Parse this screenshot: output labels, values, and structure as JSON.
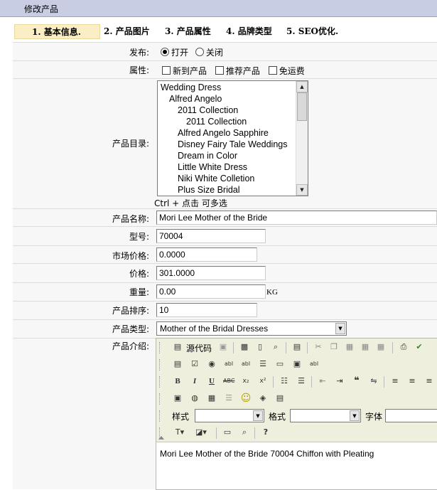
{
  "window": {
    "title": "修改产品"
  },
  "tabs": [
    {
      "label": "1. 基本信息.",
      "active": true
    },
    {
      "label": "2. 产品图片",
      "active": false
    },
    {
      "label": "3. 产品属性",
      "active": false
    },
    {
      "label": "4. 品牌类型",
      "active": false
    },
    {
      "label": "5. SEO优化.",
      "active": false
    }
  ],
  "publish": {
    "label": "发布:",
    "option_open": "打开",
    "option_close": "关闭",
    "selected": "open"
  },
  "attributes": {
    "label": "属性:",
    "options": [
      "新到产品",
      "推荐产品",
      "免运费"
    ]
  },
  "category": {
    "label": "产品目录:",
    "items": [
      "Wedding Dress",
      "Alfred Angelo",
      "2011 Collection",
      "2011 Collection",
      "Alfred Angelo Sapphire",
      "Disney Fairy Tale Weddings",
      "Dream in Color",
      "Little White Dress",
      "Niki White Colletion",
      "Plus Size Bridal"
    ],
    "hint": "Ctrl + 点击  可多选"
  },
  "name": {
    "label": "产品名称:",
    "value": "Mori Lee  Mother of the Bride"
  },
  "model": {
    "label": "型号:",
    "value": "70004"
  },
  "market_price": {
    "label": "市场价格:",
    "value": "0.0000"
  },
  "price": {
    "label": "价格:",
    "value": "301.0000"
  },
  "weight": {
    "label": "重量:",
    "value": "0.00",
    "unit": "KG"
  },
  "sort": {
    "label": "产品排序:",
    "value": "10"
  },
  "type": {
    "label": "产品类型:",
    "value": "Mother of the Bridal Dresses"
  },
  "description": {
    "label": "产品介绍:",
    "source_label": "源代码",
    "style_label": "样式",
    "format_label": "格式",
    "font_label": "字体",
    "content": "Mori Lee Mother of the Bride 70004 Chiffon with Pleating"
  },
  "colors": {
    "tab_active_bg": "#fbedc4",
    "title_bg": "#c9cde3",
    "toolbar_bg": "#efefde"
  }
}
